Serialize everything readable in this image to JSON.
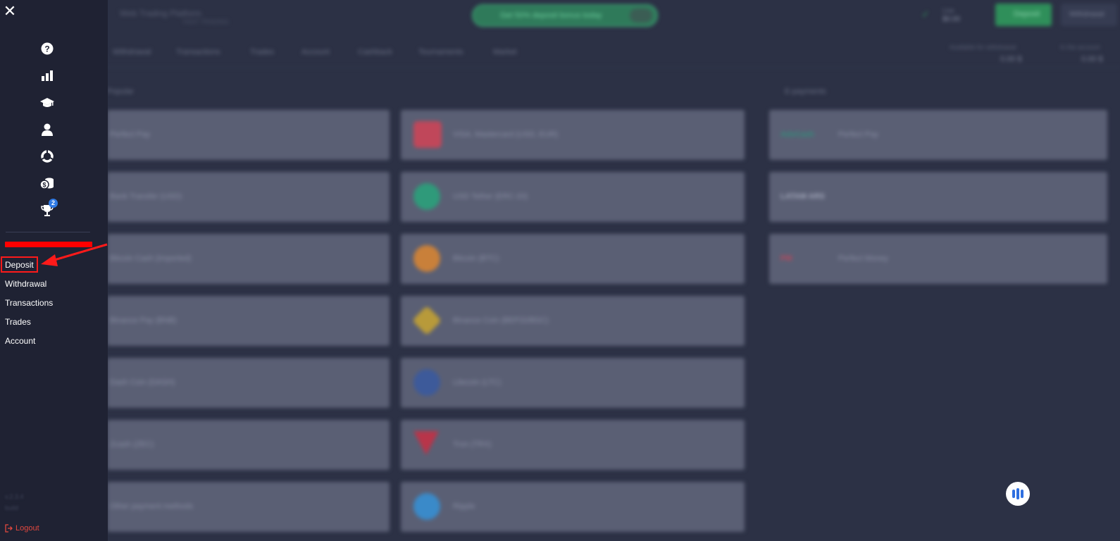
{
  "topbar": {
    "brand_line1": "Web Trading Platform",
    "brand_line2": "FAST TRADING",
    "promo_text": "Get 50% deposit bonus today",
    "promo_chip": "GO",
    "account_label": "Live",
    "account_value": "$0.00",
    "deposit_button": "Deposit",
    "withdraw_button": "Withdrawal"
  },
  "tabs": [
    {
      "label": "Withdrawal"
    },
    {
      "label": "Transactions"
    },
    {
      "label": "Trades"
    },
    {
      "label": "Account"
    },
    {
      "label": "Cashback"
    },
    {
      "label": "Tournaments"
    },
    {
      "label": "Market"
    }
  ],
  "stats": [
    {
      "label": "Available for withdrawal",
      "value": "0.00 $"
    },
    {
      "label": "In the account",
      "value": "0.00 $"
    }
  ],
  "sections": {
    "left": "Popular",
    "right": "E-payments"
  },
  "cards_col1": [
    {
      "label": "Perfect Pay"
    },
    {
      "label": "Bank Transfer (USD)"
    },
    {
      "label": "Bitcoin Cash (Imported)"
    },
    {
      "label": "Binance Pay (BNB)"
    },
    {
      "label": "Dash Coin (DASH)"
    },
    {
      "label": "Zcash (ZEC)"
    },
    {
      "label": "Other payment methods"
    }
  ],
  "cards_col2": [
    {
      "label": "VISA, Mastercard (USD, EUR)",
      "color": "#c0475a"
    },
    {
      "label": "USD Tether (ERC-20)",
      "color": "#2f9a7a"
    },
    {
      "label": "Bitcoin (BTC)",
      "color": "#c9803a"
    },
    {
      "label": "Binance Coin (BEP20/BSC)",
      "color": "#b89a3a"
    },
    {
      "label": "Litecoin (LTC)",
      "color": "#3d5a9a"
    },
    {
      "label": "Tron (TRX)",
      "color": "#b8354a"
    },
    {
      "label": "Ripple",
      "color": "#3a8ac9"
    }
  ],
  "cards_col3": [
    {
      "label": "Perfect Pay",
      "logo": "AdvCash",
      "color": "#2f8f7a"
    },
    {
      "label": "",
      "logo": "LATAM   ARS",
      "color": "#a5aabd"
    },
    {
      "label": "Perfect Money",
      "logo": "PM",
      "color": "#c0475a"
    }
  ],
  "sidebar": {
    "close_icon": "close-icon",
    "icons": [
      {
        "name": "help-icon",
        "badge": ""
      },
      {
        "name": "chart-icon",
        "badge": ""
      },
      {
        "name": "education-icon",
        "badge": ""
      },
      {
        "name": "user-icon",
        "badge": ""
      },
      {
        "name": "pie-chart-icon",
        "badge": ""
      },
      {
        "name": "coins-icon",
        "badge": ""
      },
      {
        "name": "trophy-icon",
        "badge": "2"
      }
    ],
    "menu": [
      {
        "label": "Deposit"
      },
      {
        "label": "Withdrawal"
      },
      {
        "label": "Transactions"
      },
      {
        "label": "Trades"
      },
      {
        "label": "Account"
      }
    ],
    "version_line1": "v.2.3.4",
    "version_line2": "build",
    "logout_label": "Logout"
  },
  "colors": {
    "highlight": "#ff1a1a",
    "logout": "#e2483f",
    "badge": "#2f7ae5"
  }
}
